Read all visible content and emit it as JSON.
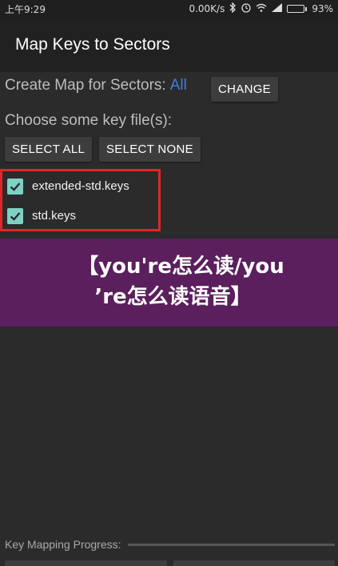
{
  "status_bar": {
    "time": "上午9:29",
    "network_speed": "0.00K/s",
    "battery": "93%",
    "battery_level": 0.93
  },
  "app_bar": {
    "title": "Map Keys to Sectors"
  },
  "sectors": {
    "label": "Create Map for Sectors:",
    "value": "All",
    "change_button": "CHANGE"
  },
  "key_files": {
    "label": "Choose some key file(s):",
    "select_all_button": "SELECT ALL",
    "select_none_button": "SELECT NONE",
    "items": [
      {
        "label": "extended-std.keys",
        "checked": true
      },
      {
        "label": "std.keys",
        "checked": true
      }
    ]
  },
  "banner": {
    "line1": "【you're怎么读/you",
    "line2": "’re怎么读语音】"
  },
  "progress": {
    "label": "Key Mapping Progress:",
    "value": 0
  },
  "colors": {
    "accent": "#3f7fd6",
    "checkbox": "#7fd1c4",
    "highlight_border": "#e02626",
    "banner_bg": "#5a1f5c"
  }
}
